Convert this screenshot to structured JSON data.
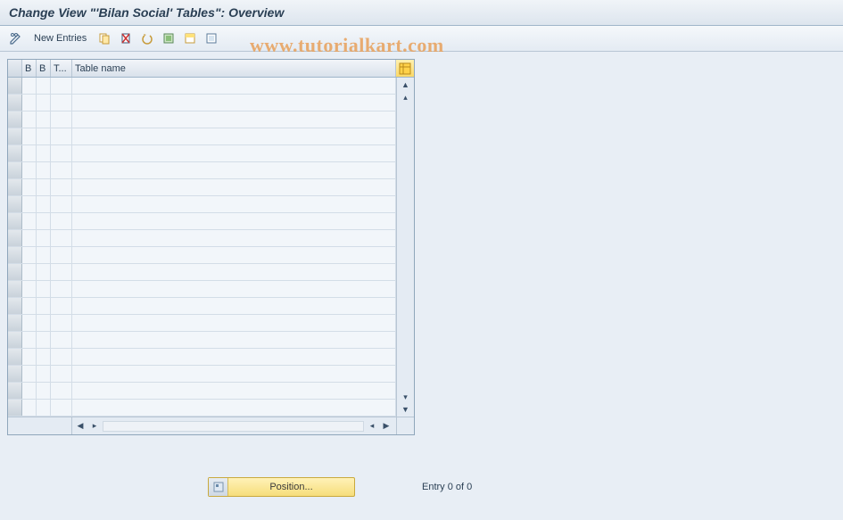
{
  "title": "Change View \"'Bilan Social' Tables\": Overview",
  "toolbar": {
    "new_entries_label": "New Entries"
  },
  "grid": {
    "headers": {
      "b1": "B",
      "b2": "B",
      "t": "T...",
      "name": "Table name"
    },
    "row_count": 20
  },
  "footer": {
    "position_label": "Position...",
    "entry_text": "Entry 0 of 0"
  },
  "watermark": "www.tutorialkart.com"
}
